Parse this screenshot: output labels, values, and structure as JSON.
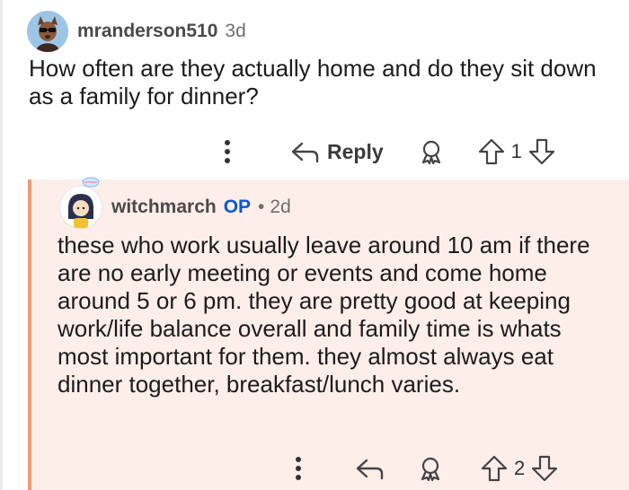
{
  "comment": {
    "author": "mranderson510",
    "age": "3d",
    "body": "How often are they actually home and do they sit down as a family for dinner?",
    "actions": {
      "reply_label": "Reply",
      "vote_count": "1"
    }
  },
  "reply": {
    "author": "witchmarch",
    "op_badge": "OP",
    "separator": "•",
    "age": "2d",
    "body": "these who work usually leave around 10 am if there are no early meeting or events and come home around 5 or 6 pm. they are pretty good at keeping work/life balance overall and family time is whats most important for them. they almost always eat dinner together, breakfast/lunch varies.",
    "actions": {
      "vote_count": "2"
    }
  },
  "colors": {
    "reply_background": "#fdeee9",
    "thread_line": "#f09a76",
    "op_badge": "#0a58d0"
  },
  "icons": [
    "more-options-icon",
    "reply-arrow-icon",
    "award-icon",
    "upvote-icon",
    "downvote-icon"
  ]
}
